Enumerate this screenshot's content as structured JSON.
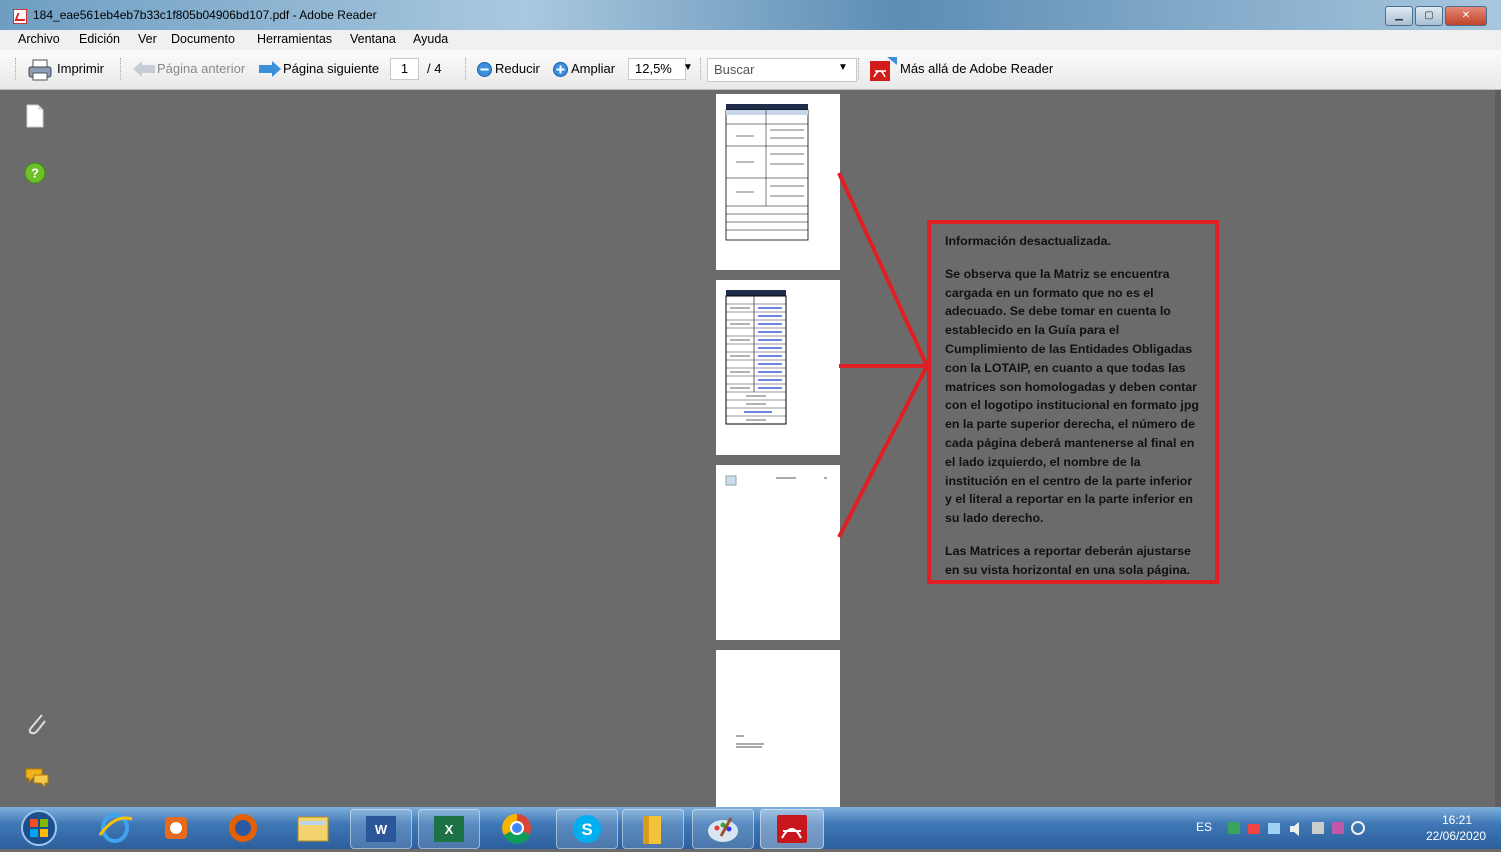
{
  "window": {
    "title": "184_eae561eb4eb7b33c1f805b04906bd107.pdf - Adobe Reader",
    "controls": [
      "minimize",
      "maximize",
      "close"
    ]
  },
  "menu": [
    "Archivo",
    "Edición",
    "Ver",
    "Documento",
    "Herramientas",
    "Ventana",
    "Ayuda"
  ],
  "toolbar": {
    "print": "Imprimir",
    "prev_page": "Página anterior",
    "next_page": "Página siguiente",
    "page_current": "1",
    "page_total": "/ 4",
    "zoom_out": "Reducir",
    "zoom_in": "Ampliar",
    "zoom_value": "12,5%",
    "search_placeholder": "Buscar",
    "adobe_link": "Más allá de Adobe Reader"
  },
  "callout": {
    "title": "Información desactualizada.",
    "paragraph1": "Se observa que la Matriz se encuentra cargada en un formato que no es el adecuado. Se debe tomar en cuenta lo establecido en la Guía para el Cumplimiento de las Entidades Obligadas con la LOTAIP, en cuanto a que todas las matrices son homologadas y deben contar con el logotipo institucional en formato jpg en la parte superior derecha, el número de cada página deberá mantenerse al final en el lado izquierdo, el nombre de la institución en el centro de la parte inferior y el literal a reportar en la parte inferior en su lado derecho.",
    "paragraph2": "Las Matrices a reportar deberán ajustarse en su vista horizontal en una sola página.",
    "border_color": "#e01f25"
  },
  "tray": {
    "lang": "ES",
    "time": "16:21",
    "date": "22/06/2020"
  },
  "taskbar_apps": [
    "start",
    "internet-explorer",
    "media-player",
    "firefox",
    "file-explorer",
    "word",
    "excel",
    "chrome",
    "skype",
    "folder",
    "paint",
    "adobe-reader"
  ]
}
